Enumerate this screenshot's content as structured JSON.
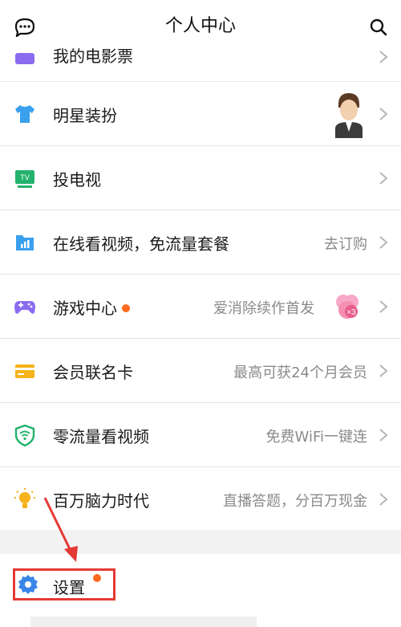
{
  "header": {
    "title": "个人中心",
    "left_icon": "message-icon",
    "right_icon": "search-icon"
  },
  "rows": [
    {
      "label": "我的电影票",
      "hint": "",
      "icon": "ticket-icon"
    },
    {
      "label": "明星装扮",
      "hint": "",
      "icon": "shirt-icon"
    },
    {
      "label": "投电视",
      "hint": "",
      "icon": "tv-icon"
    },
    {
      "label": "在线看视频，免流量套餐",
      "hint": "去订购",
      "icon": "data-plan-icon"
    },
    {
      "label": "游戏中心",
      "hint": "爱消除续作首发",
      "icon": "gamepad-icon",
      "dot": true
    },
    {
      "label": "会员联名卡",
      "hint": "最高可获24个月会员",
      "icon": "card-icon"
    },
    {
      "label": "零流量看视频",
      "hint": "免费WiFi一键连",
      "icon": "wifi-shield-icon"
    },
    {
      "label": "百万脑力时代",
      "hint": "直播答题，分百万现金",
      "icon": "lightbulb-icon"
    }
  ],
  "settings": {
    "label": "设置",
    "icon": "gear-icon",
    "dot": true
  },
  "colors": {
    "accent_red": "#e53935",
    "dot_orange": "#ff6a1f",
    "hint_gray": "#8a8a8a"
  }
}
